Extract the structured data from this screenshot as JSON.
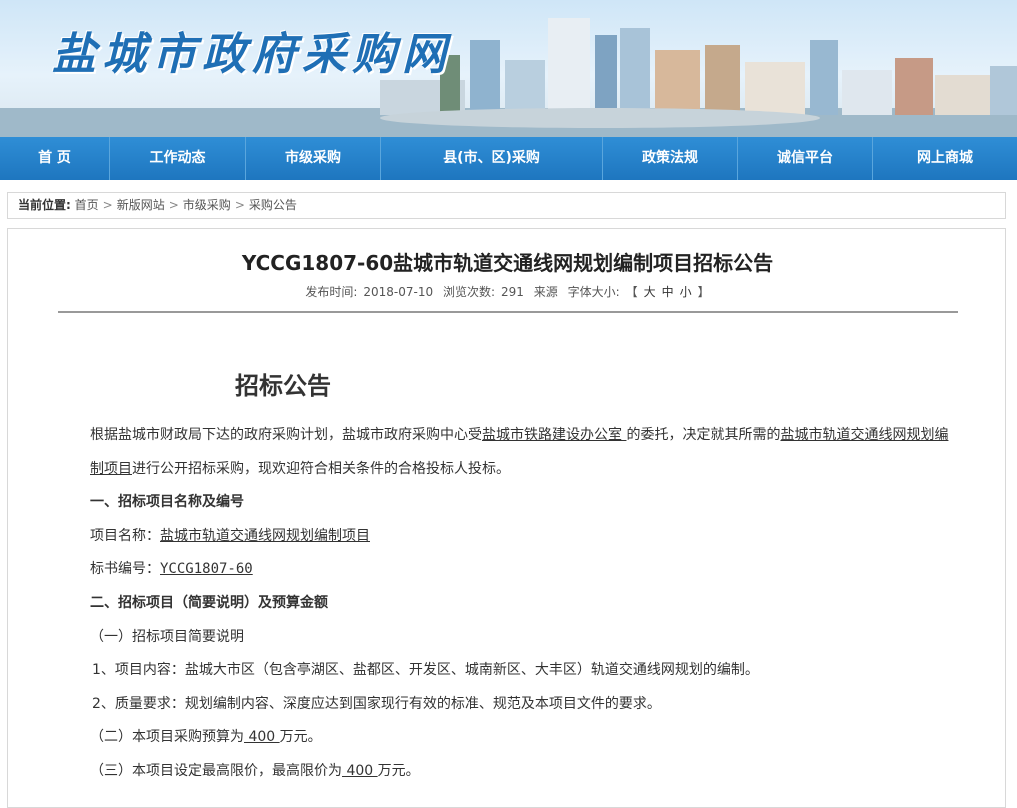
{
  "header": {
    "site_title": "盐城市政府采购网"
  },
  "nav": [
    {
      "label": "首  页",
      "w": 110
    },
    {
      "label": "工作动态",
      "w": 136
    },
    {
      "label": "市级采购",
      "w": 135
    },
    {
      "label": "县(市、区)采购",
      "w": 222
    },
    {
      "label": "政策法规",
      "w": 135
    },
    {
      "label": "诚信平台",
      "w": 135
    },
    {
      "label": "网上商城",
      "w": 144
    }
  ],
  "breadcrumb": {
    "label": "当前位置:",
    "items": [
      "首页",
      "新版网站",
      "市级采购",
      "采购公告"
    ],
    "separator": ">"
  },
  "article": {
    "title": "YCCG1807-60盐城市轨道交通线网规划编制项目招标公告",
    "meta": {
      "publish_label": "发布时间:",
      "publish_date": "2018-07-10",
      "views_label": "浏览次数:",
      "views": "291",
      "source_label": "来源",
      "font_label": "字体大小:",
      "font_open": "【",
      "font_large": "大",
      "font_medium": "中",
      "font_small": "小",
      "font_close": "】"
    },
    "heading": "招标公告",
    "intro_1": "根据盐城市财政局下达的政府采购计划，盐城市政府采购中心受",
    "intro_client": "盐城市铁路建设办公室 ",
    "intro_2": "的委托，决定就其所需的",
    "intro_project": "盐城市轨道交通线网规划编制项目",
    "intro_3": "进行公开招标采购，现欢迎符合相关条件的合格投标人投标。",
    "sec1_title": "一、招标项目名称及编号",
    "name_label": "项目名称：",
    "name_value": "盐城市轨道交通线网规划编制项目",
    "code_label": "标书编号：",
    "code_value": "YCCG1807-60",
    "sec2_title": "二、招标项目（简要说明）及预算金额",
    "sub1": "（一）招标项目简要说明",
    "item1": "1、项目内容：盐城大市区（包含亭湖区、盐都区、开发区、城南新区、大丰区）轨道交通线网规划的编制。",
    "item2": "2、质量要求：规划编制内容、深度应达到国家现行有效的标准、规范及本项目文件的要求。",
    "budget_pre": "（二）本项目采购预算为",
    "budget_value": " 400 ",
    "budget_post": "万元。",
    "max_pre": "（三）本项目设定最高限价，最高限价为",
    "max_value": " 400 ",
    "max_post": "万元。"
  }
}
